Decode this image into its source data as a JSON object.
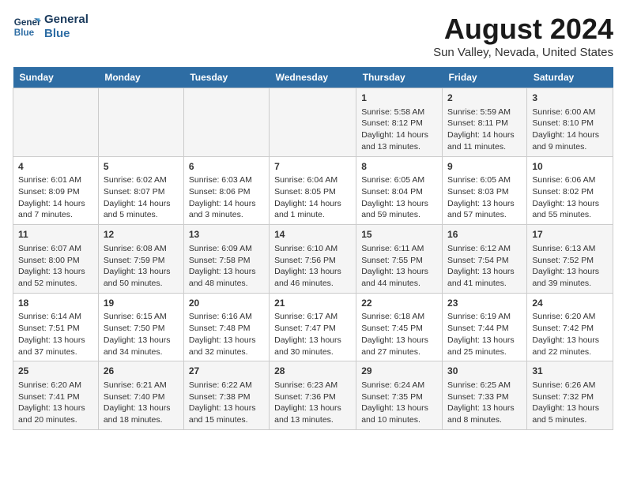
{
  "header": {
    "logo_line1": "General",
    "logo_line2": "Blue",
    "month_title": "August 2024",
    "location": "Sun Valley, Nevada, United States"
  },
  "calendar": {
    "weekdays": [
      "Sunday",
      "Monday",
      "Tuesday",
      "Wednesday",
      "Thursday",
      "Friday",
      "Saturday"
    ],
    "weeks": [
      [
        {
          "day": "",
          "content": ""
        },
        {
          "day": "",
          "content": ""
        },
        {
          "day": "",
          "content": ""
        },
        {
          "day": "",
          "content": ""
        },
        {
          "day": "1",
          "content": "Sunrise: 5:58 AM\nSunset: 8:12 PM\nDaylight: 14 hours\nand 13 minutes."
        },
        {
          "day": "2",
          "content": "Sunrise: 5:59 AM\nSunset: 8:11 PM\nDaylight: 14 hours\nand 11 minutes."
        },
        {
          "day": "3",
          "content": "Sunrise: 6:00 AM\nSunset: 8:10 PM\nDaylight: 14 hours\nand 9 minutes."
        }
      ],
      [
        {
          "day": "4",
          "content": "Sunrise: 6:01 AM\nSunset: 8:09 PM\nDaylight: 14 hours\nand 7 minutes."
        },
        {
          "day": "5",
          "content": "Sunrise: 6:02 AM\nSunset: 8:07 PM\nDaylight: 14 hours\nand 5 minutes."
        },
        {
          "day": "6",
          "content": "Sunrise: 6:03 AM\nSunset: 8:06 PM\nDaylight: 14 hours\nand 3 minutes."
        },
        {
          "day": "7",
          "content": "Sunrise: 6:04 AM\nSunset: 8:05 PM\nDaylight: 14 hours\nand 1 minute."
        },
        {
          "day": "8",
          "content": "Sunrise: 6:05 AM\nSunset: 8:04 PM\nDaylight: 13 hours\nand 59 minutes."
        },
        {
          "day": "9",
          "content": "Sunrise: 6:05 AM\nSunset: 8:03 PM\nDaylight: 13 hours\nand 57 minutes."
        },
        {
          "day": "10",
          "content": "Sunrise: 6:06 AM\nSunset: 8:02 PM\nDaylight: 13 hours\nand 55 minutes."
        }
      ],
      [
        {
          "day": "11",
          "content": "Sunrise: 6:07 AM\nSunset: 8:00 PM\nDaylight: 13 hours\nand 52 minutes."
        },
        {
          "day": "12",
          "content": "Sunrise: 6:08 AM\nSunset: 7:59 PM\nDaylight: 13 hours\nand 50 minutes."
        },
        {
          "day": "13",
          "content": "Sunrise: 6:09 AM\nSunset: 7:58 PM\nDaylight: 13 hours\nand 48 minutes."
        },
        {
          "day": "14",
          "content": "Sunrise: 6:10 AM\nSunset: 7:56 PM\nDaylight: 13 hours\nand 46 minutes."
        },
        {
          "day": "15",
          "content": "Sunrise: 6:11 AM\nSunset: 7:55 PM\nDaylight: 13 hours\nand 44 minutes."
        },
        {
          "day": "16",
          "content": "Sunrise: 6:12 AM\nSunset: 7:54 PM\nDaylight: 13 hours\nand 41 minutes."
        },
        {
          "day": "17",
          "content": "Sunrise: 6:13 AM\nSunset: 7:52 PM\nDaylight: 13 hours\nand 39 minutes."
        }
      ],
      [
        {
          "day": "18",
          "content": "Sunrise: 6:14 AM\nSunset: 7:51 PM\nDaylight: 13 hours\nand 37 minutes."
        },
        {
          "day": "19",
          "content": "Sunrise: 6:15 AM\nSunset: 7:50 PM\nDaylight: 13 hours\nand 34 minutes."
        },
        {
          "day": "20",
          "content": "Sunrise: 6:16 AM\nSunset: 7:48 PM\nDaylight: 13 hours\nand 32 minutes."
        },
        {
          "day": "21",
          "content": "Sunrise: 6:17 AM\nSunset: 7:47 PM\nDaylight: 13 hours\nand 30 minutes."
        },
        {
          "day": "22",
          "content": "Sunrise: 6:18 AM\nSunset: 7:45 PM\nDaylight: 13 hours\nand 27 minutes."
        },
        {
          "day": "23",
          "content": "Sunrise: 6:19 AM\nSunset: 7:44 PM\nDaylight: 13 hours\nand 25 minutes."
        },
        {
          "day": "24",
          "content": "Sunrise: 6:20 AM\nSunset: 7:42 PM\nDaylight: 13 hours\nand 22 minutes."
        }
      ],
      [
        {
          "day": "25",
          "content": "Sunrise: 6:20 AM\nSunset: 7:41 PM\nDaylight: 13 hours\nand 20 minutes."
        },
        {
          "day": "26",
          "content": "Sunrise: 6:21 AM\nSunset: 7:40 PM\nDaylight: 13 hours\nand 18 minutes."
        },
        {
          "day": "27",
          "content": "Sunrise: 6:22 AM\nSunset: 7:38 PM\nDaylight: 13 hours\nand 15 minutes."
        },
        {
          "day": "28",
          "content": "Sunrise: 6:23 AM\nSunset: 7:36 PM\nDaylight: 13 hours\nand 13 minutes."
        },
        {
          "day": "29",
          "content": "Sunrise: 6:24 AM\nSunset: 7:35 PM\nDaylight: 13 hours\nand 10 minutes."
        },
        {
          "day": "30",
          "content": "Sunrise: 6:25 AM\nSunset: 7:33 PM\nDaylight: 13 hours\nand 8 minutes."
        },
        {
          "day": "31",
          "content": "Sunrise: 6:26 AM\nSunset: 7:32 PM\nDaylight: 13 hours\nand 5 minutes."
        }
      ]
    ]
  }
}
